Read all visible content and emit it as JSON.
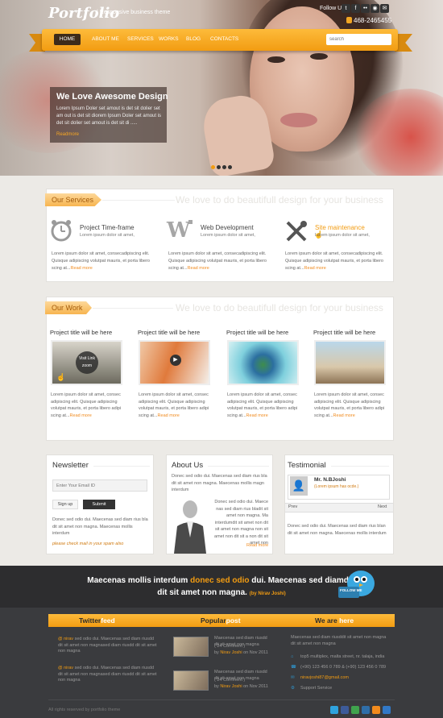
{
  "header": {
    "logo": "Portfolio",
    "tagline": "| Responsive business theme",
    "follow_us": "Follow Us :",
    "phone": "468-2465455",
    "social_icons": [
      "twitter-icon",
      "facebook-icon",
      "flickr-icon",
      "rss-icon",
      "mail-icon"
    ]
  },
  "nav": {
    "items": [
      "HOME",
      "ABOUT ME",
      "SERVICES",
      "WORKS",
      "BLOG",
      "CONTACTS"
    ],
    "search_placeholder": "search"
  },
  "hero": {
    "title": "We Love Awesome Design",
    "text": "Lorem Ipsum Doler set amout is det sit dolier set am out is det sit diorem Ipsum Doler set amout is det sit dolier set amout is det sit di .....",
    "more": "Readmore",
    "slides": 4,
    "active_slide": 1
  },
  "services": {
    "heading": "Our Services",
    "slogan": "We love to do beautifull design for your business",
    "items": [
      {
        "title": "Project Time-frame",
        "sub": "Lorem ipsum dolor sit amet,",
        "text": "Lorem ipsum dolor sit amet, consecadipiscing elit. Quisque adipiscing volutpat mauris, et porta libero scing at...",
        "more": "Read more"
      },
      {
        "title": "Web Development",
        "sub": "Lorem ipsum dolor sit amet,",
        "text": "Lorem ipsum dolor sit amet, consecadipiscing elit. Quisque adipiscing volutpat mauris, et porta libero scing at...",
        "more": "Read more"
      },
      {
        "title": "Site maintenance",
        "sub": "Lorem ipsum dolor sit amet,",
        "text": "Lorem ipsum dolor sit amet, consecadipiscing elit. Quisque adipiscing volutpat mauris, et porta libero scing at...",
        "more": "Read more"
      }
    ]
  },
  "work": {
    "heading": "Our Work",
    "slogan": "We love to do beautifull design for your business",
    "items": [
      {
        "title": "Project title will be here",
        "overlay": "Visit Link  zoom",
        "text": "Lorem ipsum dolor sit amet, consec adipiscing elit. Quisque adipiscing volutpat mauris, et porta libero adipi scing at...",
        "more": "Read more"
      },
      {
        "title": "Project title will be here",
        "text": "Lorem ipsum dolor sit amet, consec adipiscing elit. Quisque adipiscing volutpat mauris, et porta libero adipi scing at...",
        "more": "Read more"
      },
      {
        "title": "Project title will be here",
        "text": "Lorem ipsum dolor sit amet, consec adipiscing elit. Quisque adipiscing volutpat mauris, et porta libero adipi scing at...",
        "more": "Read more"
      },
      {
        "title": "Project title will be here",
        "text": "Lorem ipsum dolor sit amet, consec adipiscing elit. Quisque adipiscing volutpat mauris, et porta libero adipi scing at...",
        "more": "Read more"
      }
    ]
  },
  "newsletter": {
    "title": "Newsletter",
    "placeholder": "Enter Your Email ID",
    "signup": "Sign up",
    "submit": "Submit",
    "text": "Donec sed odio dui. Maecenas sed diam rius bla dit sit amet non magna. Maecenas mollis interdum",
    "note": "please check mail in your spam also"
  },
  "about": {
    "title": "About Us",
    "intro": "Donec sed odio dui. Maecenas sed diam rius bla dit sit amet non magna. Maecenas mollis magn interdum",
    "text": "Donec sed odio dui. Maece nas sed diam rius bladit sit amet non magna. Ma interdumdit sit amet non dit sit amet non magna non sit amet non dit sit a non dit sit amet non",
    "more": "Read more"
  },
  "testimonial": {
    "title": "Testimonial",
    "name": "Mr. N.BJoshi",
    "role": "(Lorem ipsum has ocde.)",
    "prev": "Prev",
    "next": "Next",
    "text": "Donec sed odio dui. Maecenas sed diam rius blan dit sit amet non magna. Maecenas mollis interdum"
  },
  "banner": {
    "text_a": "Maecenas mollis interdum ",
    "text_highlight": "donec sed odio",
    "text_b": " dui. Maecenas sed diamdsf",
    "text_c": "dit sit amet non magna. ",
    "byline": "(by Nirav Joshi)",
    "bird_label": "FOLLOW ME"
  },
  "footer": {
    "twitter": {
      "heading_a": "Twitter",
      "heading_b": "feed",
      "tweets": [
        {
          "handle": "@ nirav",
          "text": "sed odio dui. Maecenas sed diam riusdd dit sit amet non magnased diam riusdd dit sit amet non magna"
        },
        {
          "handle": "@ nirav",
          "text": "sed odio dui. Maecenas sed diam riusdd dit sit amet non magnased diam riusdd dit sit amet non magna"
        }
      ]
    },
    "popular": {
      "heading_a": "Popular",
      "heading_b": "post",
      "posts": [
        {
          "title": "Maecenas sed diam riusdd dit sit amet non magna",
          "comments": "( 24 Comment )",
          "by": "by ",
          "author": "Nirav Joshi",
          "date": " on Nov 2011"
        },
        {
          "title": "Maecenas sed diam riusdd dit sit amet non magna",
          "comments": "( 24 Comment )",
          "by": "by ",
          "author": "Nirav Joshi",
          "date": " on Nov 2011"
        }
      ]
    },
    "contact": {
      "heading_a": "We are ",
      "heading_b": "here",
      "intro": "Maecenas sed diam riusddit sit amet non magna dit sit amet non magna",
      "address": "top5 multiplex, malta street, nr. talaja, india",
      "phone": "(+90) 123 456 0 789 & (+90) 123 456 0 789",
      "email": "niravjoshi87@gmail.com",
      "support": "Support Service"
    },
    "copyright": "All rights reserved by portfolio theme",
    "social_icons": [
      "twitter-icon",
      "facebook-icon",
      "stumble-icon",
      "digg-icon",
      "rss-icon",
      "delicious-icon"
    ]
  },
  "colors": {
    "accent": "#f29c12",
    "link": "#f08a1d",
    "dark": "#2d2d2f"
  }
}
